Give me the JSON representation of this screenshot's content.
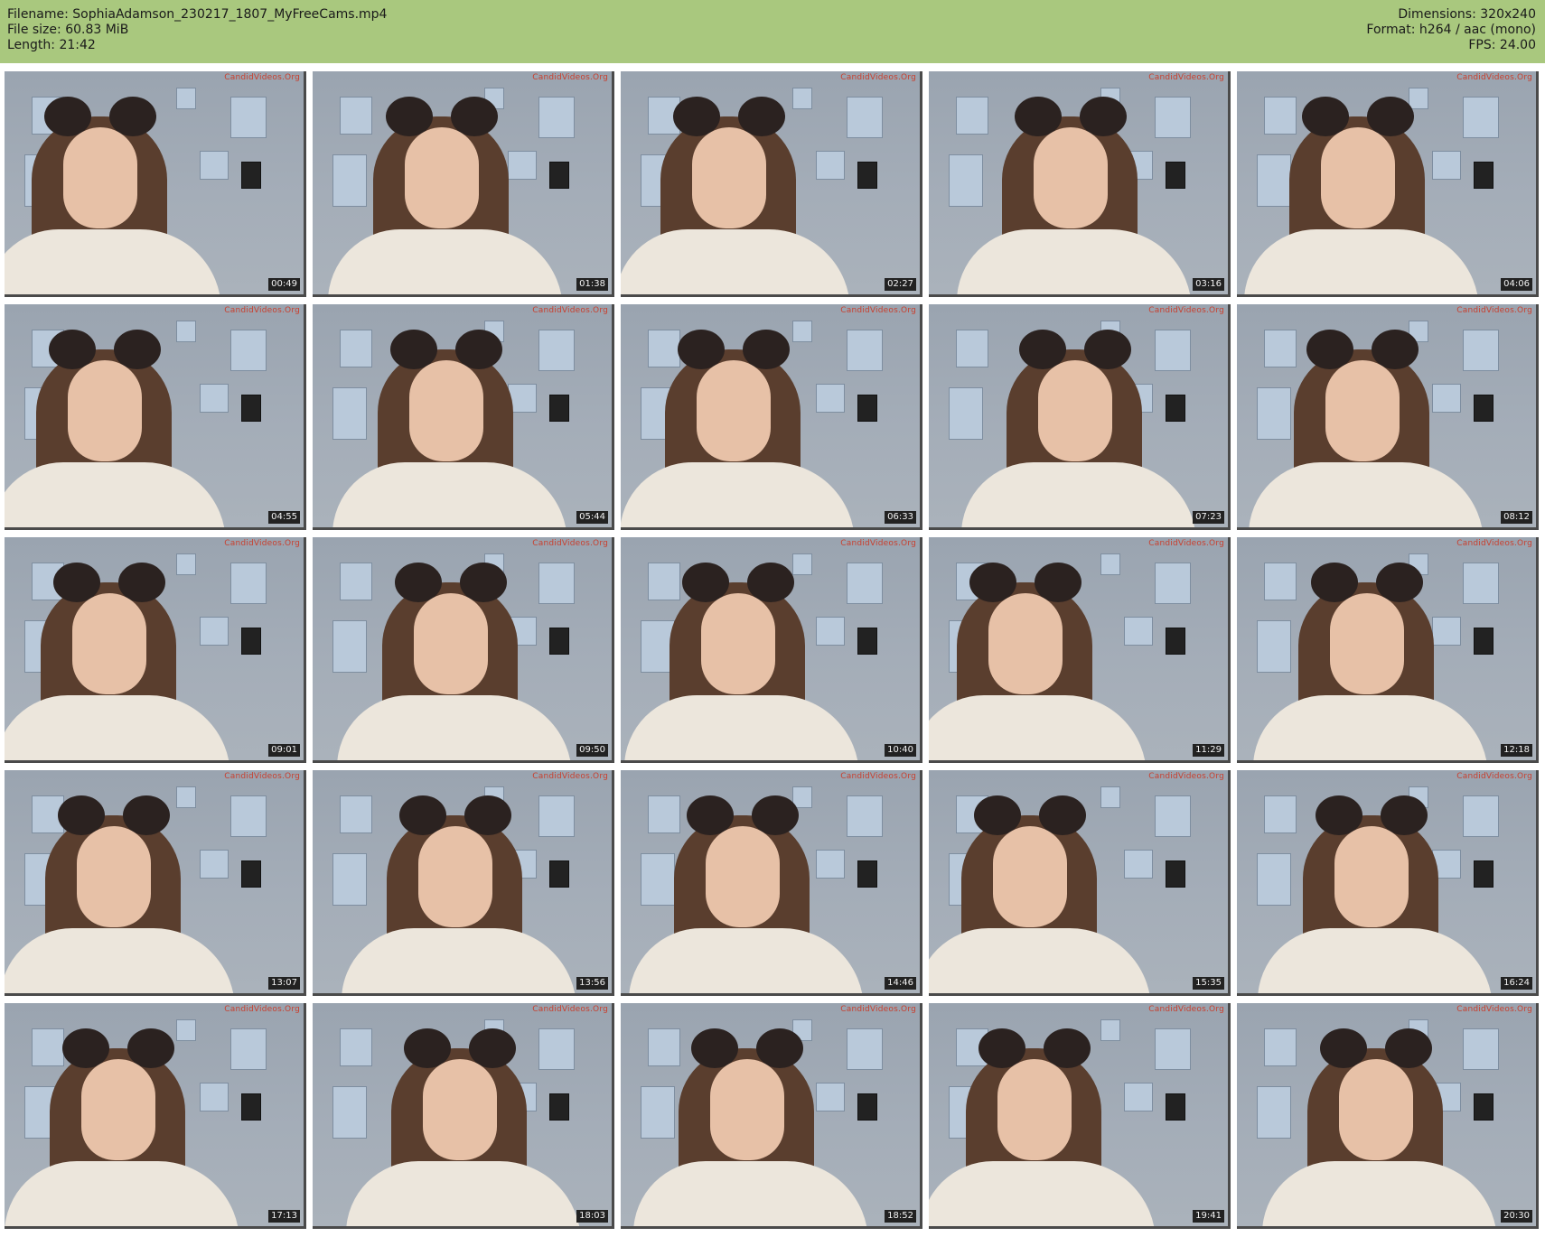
{
  "header": {
    "filename": "Filename: SophiaAdamson_230217_1807_MyFreeCams.mp4",
    "filesize": "File size: 60.83 MiB",
    "length": "Length: 21:42",
    "dimensions": "Dimensions: 320x240",
    "format": "Format: h264 / aac (mono)",
    "fps": "FPS: 24.00"
  },
  "watermark": "CandidVideos.Org",
  "thumbnails": [
    {
      "timestamp": "00:49"
    },
    {
      "timestamp": "01:38"
    },
    {
      "timestamp": "02:27"
    },
    {
      "timestamp": "03:16"
    },
    {
      "timestamp": "04:06"
    },
    {
      "timestamp": "04:55"
    },
    {
      "timestamp": "05:44"
    },
    {
      "timestamp": "06:33"
    },
    {
      "timestamp": "07:23"
    },
    {
      "timestamp": "08:12"
    },
    {
      "timestamp": "09:01"
    },
    {
      "timestamp": "09:50"
    },
    {
      "timestamp": "10:40"
    },
    {
      "timestamp": "11:29"
    },
    {
      "timestamp": "12:18"
    },
    {
      "timestamp": "13:07"
    },
    {
      "timestamp": "13:56"
    },
    {
      "timestamp": "14:46"
    },
    {
      "timestamp": "15:35"
    },
    {
      "timestamp": "16:24"
    },
    {
      "timestamp": "17:13"
    },
    {
      "timestamp": "18:03"
    },
    {
      "timestamp": "18:52"
    },
    {
      "timestamp": "19:41"
    },
    {
      "timestamp": "20:30"
    }
  ]
}
